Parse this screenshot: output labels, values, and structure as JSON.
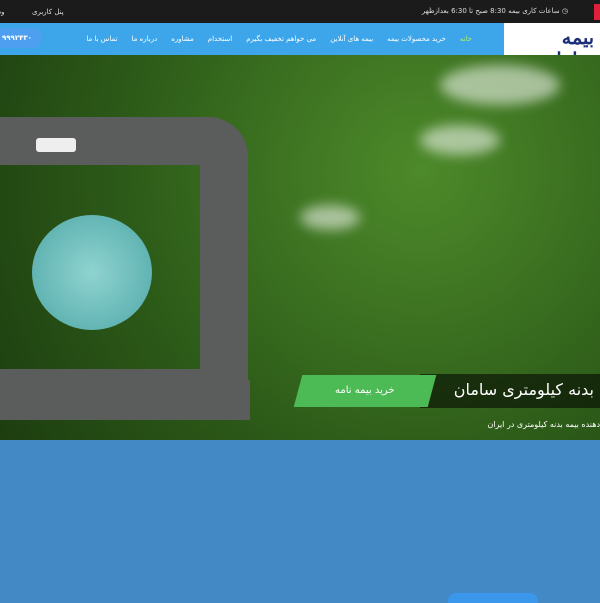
{
  "topbar": {
    "hours": "ساعات کاری بیمه 8:30 صبح تا 6:30 بعدازظهر",
    "panel": "پنل کاربری",
    "login": "ود"
  },
  "nav": {
    "logo": "بیمه سامان",
    "phone": "۹۹۹۲۴۳۰",
    "items": [
      {
        "label": "خانه"
      },
      {
        "label": "خرید محصولات بیمه"
      },
      {
        "label": "بیمه های آنلاین"
      },
      {
        "label": "می خواهم تخفیف بگیرم"
      },
      {
        "label": "استخدام"
      },
      {
        "label": "مشاوره"
      },
      {
        "label": "درباره ما"
      },
      {
        "label": "تماس با ما"
      }
    ]
  },
  "hero": {
    "title": "بدنه کیلومتری سامان",
    "button": "خرید بیمه نامه",
    "subtitle": "دهنده بیمه بدنه کیلومتری در ایران"
  },
  "colors": {
    "nav": "#3da6ea",
    "active": "#a8f07a",
    "button": "#4dbb55",
    "page": "#4389c6"
  }
}
